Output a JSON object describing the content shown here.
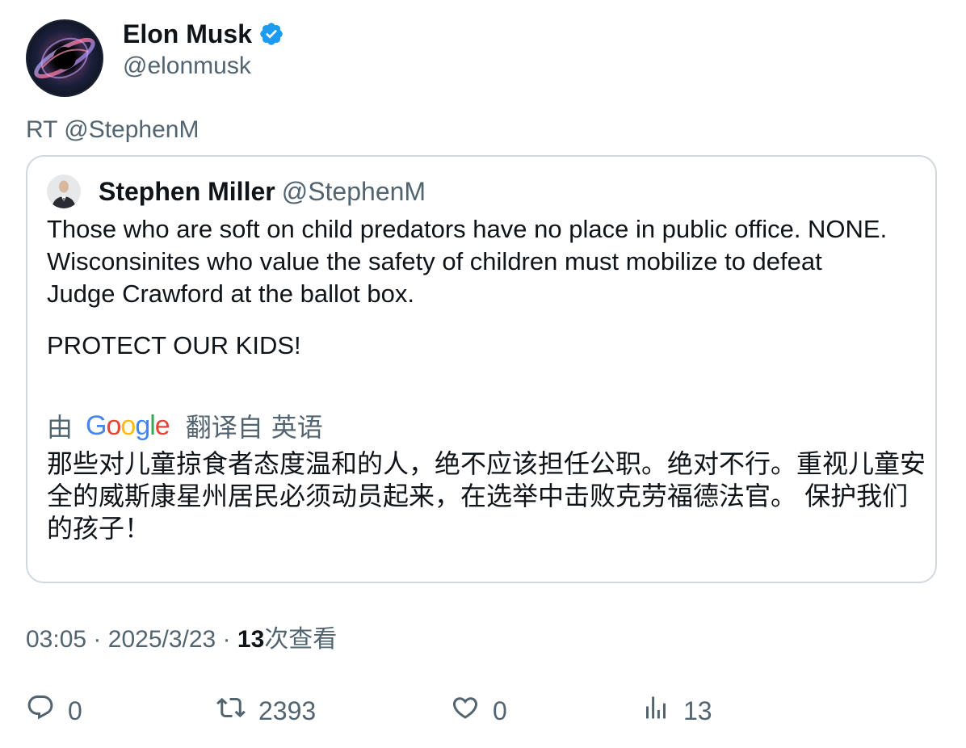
{
  "author": {
    "name": "Elon Musk",
    "handle": "@elonmusk",
    "verified": true
  },
  "retweet_label": "RT @StephenM",
  "quoted": {
    "name": "Stephen Miller",
    "handle": "@StephenM",
    "text_lines": [
      "Those who are soft on child predators have no place in public office. NONE.",
      "Wisconsinites who value the safety of children must mobilize to defeat",
      "Judge Crawford at the ballot box."
    ],
    "text_second_paragraph": "PROTECT OUR KIDS!",
    "translation": {
      "by": "由",
      "provider": "Google",
      "translated_from": "翻译自",
      "language": "英语",
      "text": "那些对儿童掠食者态度温和的人，绝不应该担任公职。绝对不行。重视儿童安全的威斯康星州居民必须动员起来，在选举中击败克劳福德法官。 保护我们的孩子！"
    }
  },
  "meta": {
    "time": "03:05",
    "separator": "·",
    "date": "2025/3/23",
    "views_count": "13",
    "views_label": "次查看"
  },
  "actions": {
    "replies": "0",
    "reposts": "2393",
    "likes": "0",
    "views": "13"
  },
  "colors": {
    "verified_badge": "#1d9bf0",
    "secondary_text": "#536471",
    "primary_text": "#0f1419",
    "border": "#cfd9de"
  },
  "icons": {
    "reply": "reply-icon",
    "repost": "repost-icon",
    "like": "heart-icon",
    "views": "views-bar-chart-icon",
    "verified": "verified-badge-icon"
  }
}
